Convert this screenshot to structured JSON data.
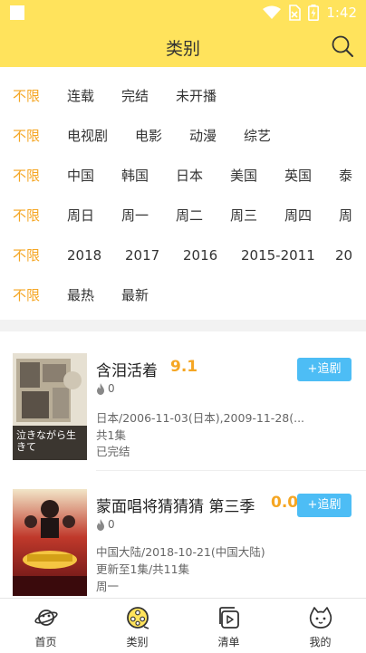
{
  "status_bar": {
    "time": "1:42",
    "icons": [
      "wifi-icon",
      "no-sim-icon",
      "battery-icon"
    ]
  },
  "header": {
    "title": "类别",
    "search_icon": "search-icon"
  },
  "filters": {
    "rows": [
      [
        "不限",
        "连载",
        "完结",
        "未开播"
      ],
      [
        "不限",
        "电视剧",
        "电影",
        "动漫",
        "综艺"
      ],
      [
        "不限",
        "中国",
        "韩国",
        "日本",
        "美国",
        "英国",
        "泰"
      ],
      [
        "不限",
        "周日",
        "周一",
        "周二",
        "周三",
        "周四",
        "周"
      ],
      [
        "不限",
        "2018",
        "2017",
        "2016",
        "2015-2011",
        "20"
      ],
      [
        "不限",
        "最热",
        "最新"
      ]
    ]
  },
  "items": [
    {
      "title": "含泪活着",
      "score": "9.1",
      "hot": "0",
      "line1": "日本/2006-11-03(日本),2009-11-28(...",
      "line2": "共1集",
      "line3": "已完结",
      "follow_label": "+追剧",
      "poster_text": "泣きながら生きて"
    },
    {
      "title": "蒙面唱将猜猜猜 第三季",
      "score": "0.0",
      "hot": "0",
      "line1": "中国大陆/2018-10-21(中国大陆)",
      "line2": "更新至1集/共11集",
      "line3": "周一",
      "follow_label": "+追剧"
    }
  ],
  "tabs": [
    {
      "label": "首页",
      "icon": "planet-icon"
    },
    {
      "label": "类别",
      "icon": "film-reel-icon"
    },
    {
      "label": "清单",
      "icon": "playlist-icon"
    },
    {
      "label": "我的",
      "icon": "cat-icon"
    }
  ],
  "colors": {
    "accent_yellow": "#FFE35C",
    "active_orange": "#F5A623",
    "button_blue": "#4DBDF5"
  }
}
